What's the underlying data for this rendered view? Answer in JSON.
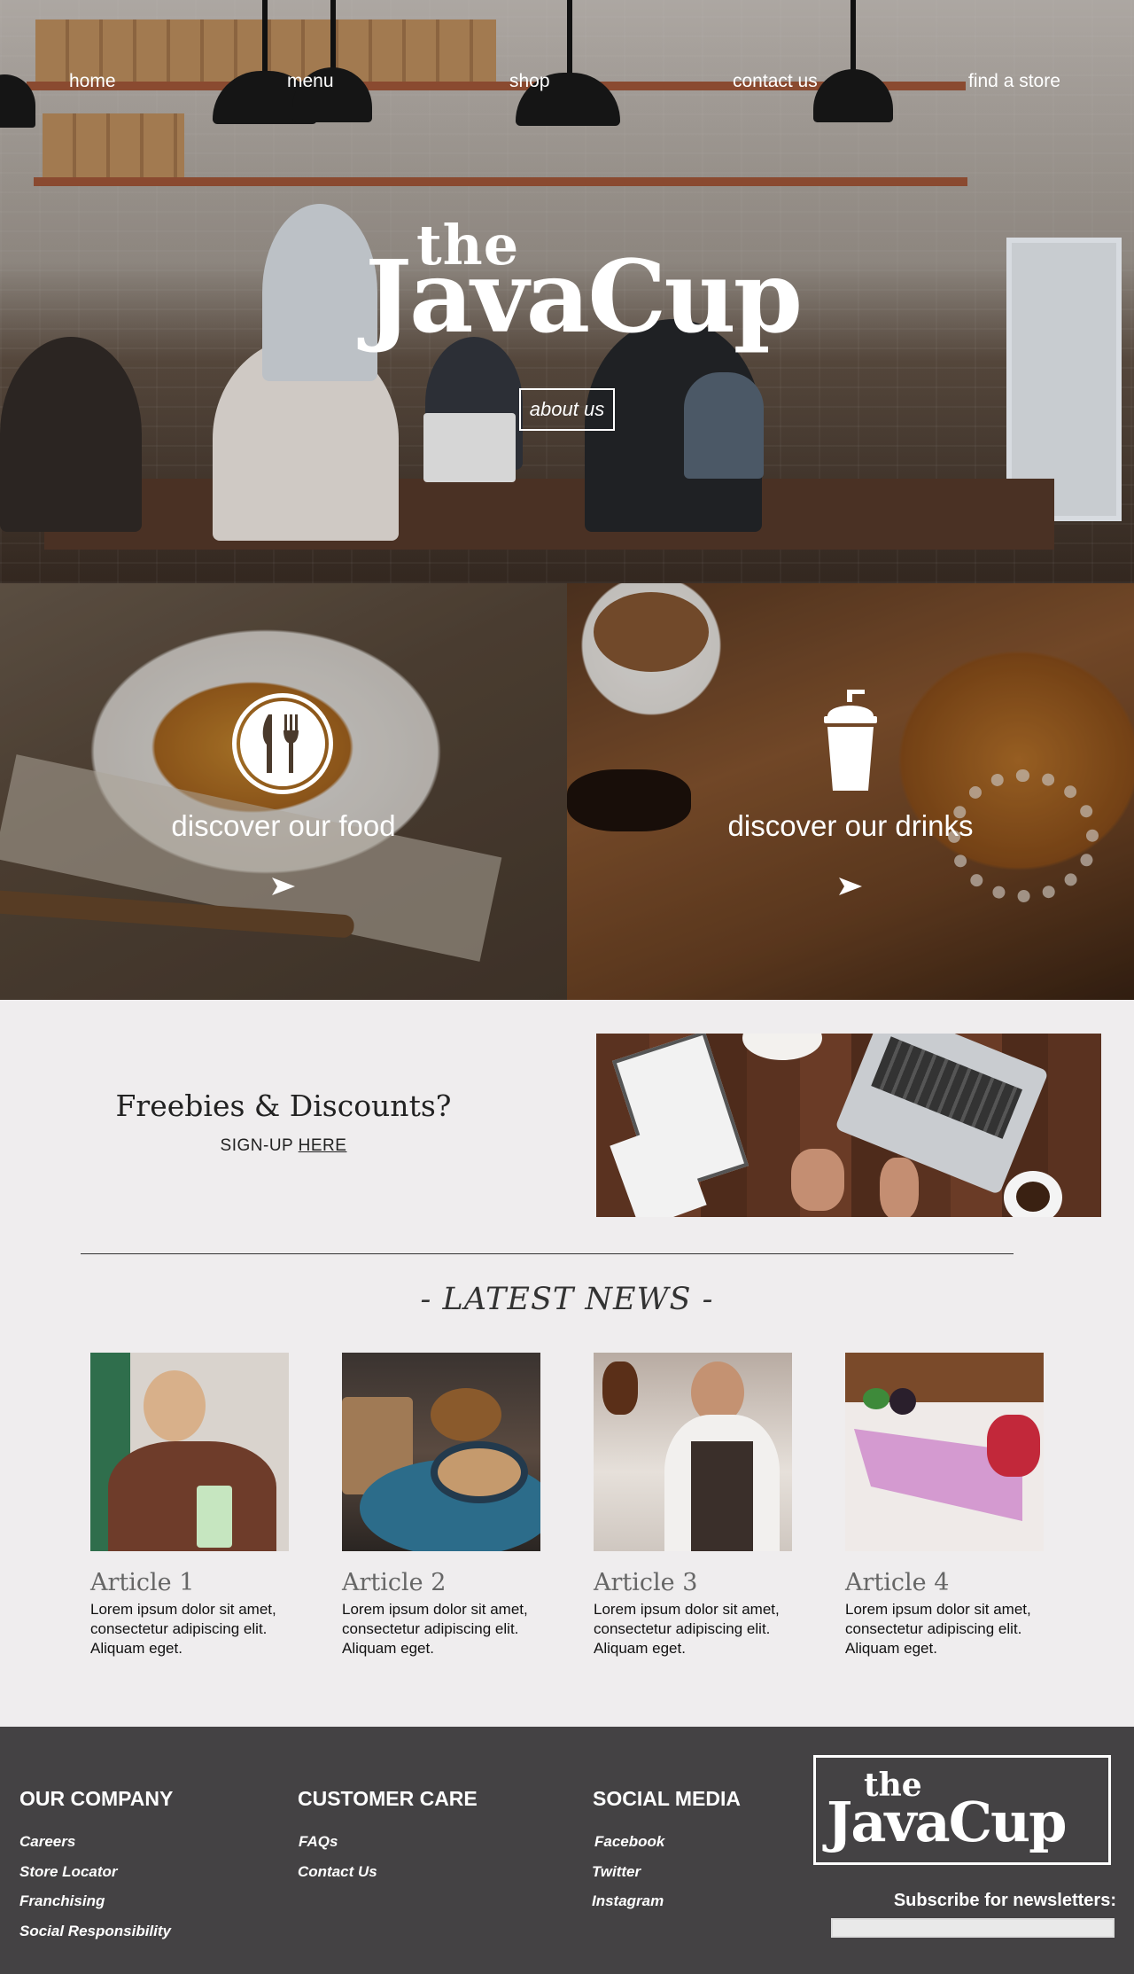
{
  "nav": {
    "items": [
      "home",
      "menu",
      "shop",
      "contact us",
      "find a store"
    ]
  },
  "hero": {
    "logo_the": "the",
    "logo_main": "JavaCup",
    "about_label": "about us"
  },
  "discover": {
    "food_label": "discover our food",
    "drinks_label": "discover our drinks"
  },
  "freebies": {
    "title": "Freebies & Discounts?",
    "signup_prefix": "SIGN-UP ",
    "signup_link": "HERE"
  },
  "news": {
    "title": "- LATEST NEWS -",
    "articles": [
      {
        "title": "Article 1",
        "body": "Lorem ipsum dolor sit amet, consectetur adipiscing elit. Aliquam eget."
      },
      {
        "title": "Article 2",
        "body": "Lorem ipsum dolor sit amet, consectetur adipiscing elit. Aliquam eget."
      },
      {
        "title": "Article 3",
        "body": "Lorem ipsum dolor sit amet, consectetur adipiscing elit. Aliquam eget."
      },
      {
        "title": "Article 4",
        "body": "Lorem ipsum dolor sit amet, consectetur adipiscing elit. Aliquam eget."
      }
    ]
  },
  "footer": {
    "company": {
      "heading": "OUR COMPANY",
      "links": [
        "Careers",
        "Store Locator",
        "Franchising",
        "Social Responsibility"
      ]
    },
    "care": {
      "heading": "CUSTOMER CARE",
      "links": [
        "FAQs",
        "Contact Us"
      ]
    },
    "social": {
      "heading": "SOCIAL MEDIA",
      "links": [
        "Facebook",
        "Twitter",
        "Instagram"
      ]
    },
    "logo_the": "the",
    "logo_main": "JavaCup",
    "subscribe_label": "Subscribe for newsletters:",
    "subscribe_value": ""
  },
  "colors": {
    "footer_bg": "#444244",
    "page_bg": "#efedee"
  }
}
